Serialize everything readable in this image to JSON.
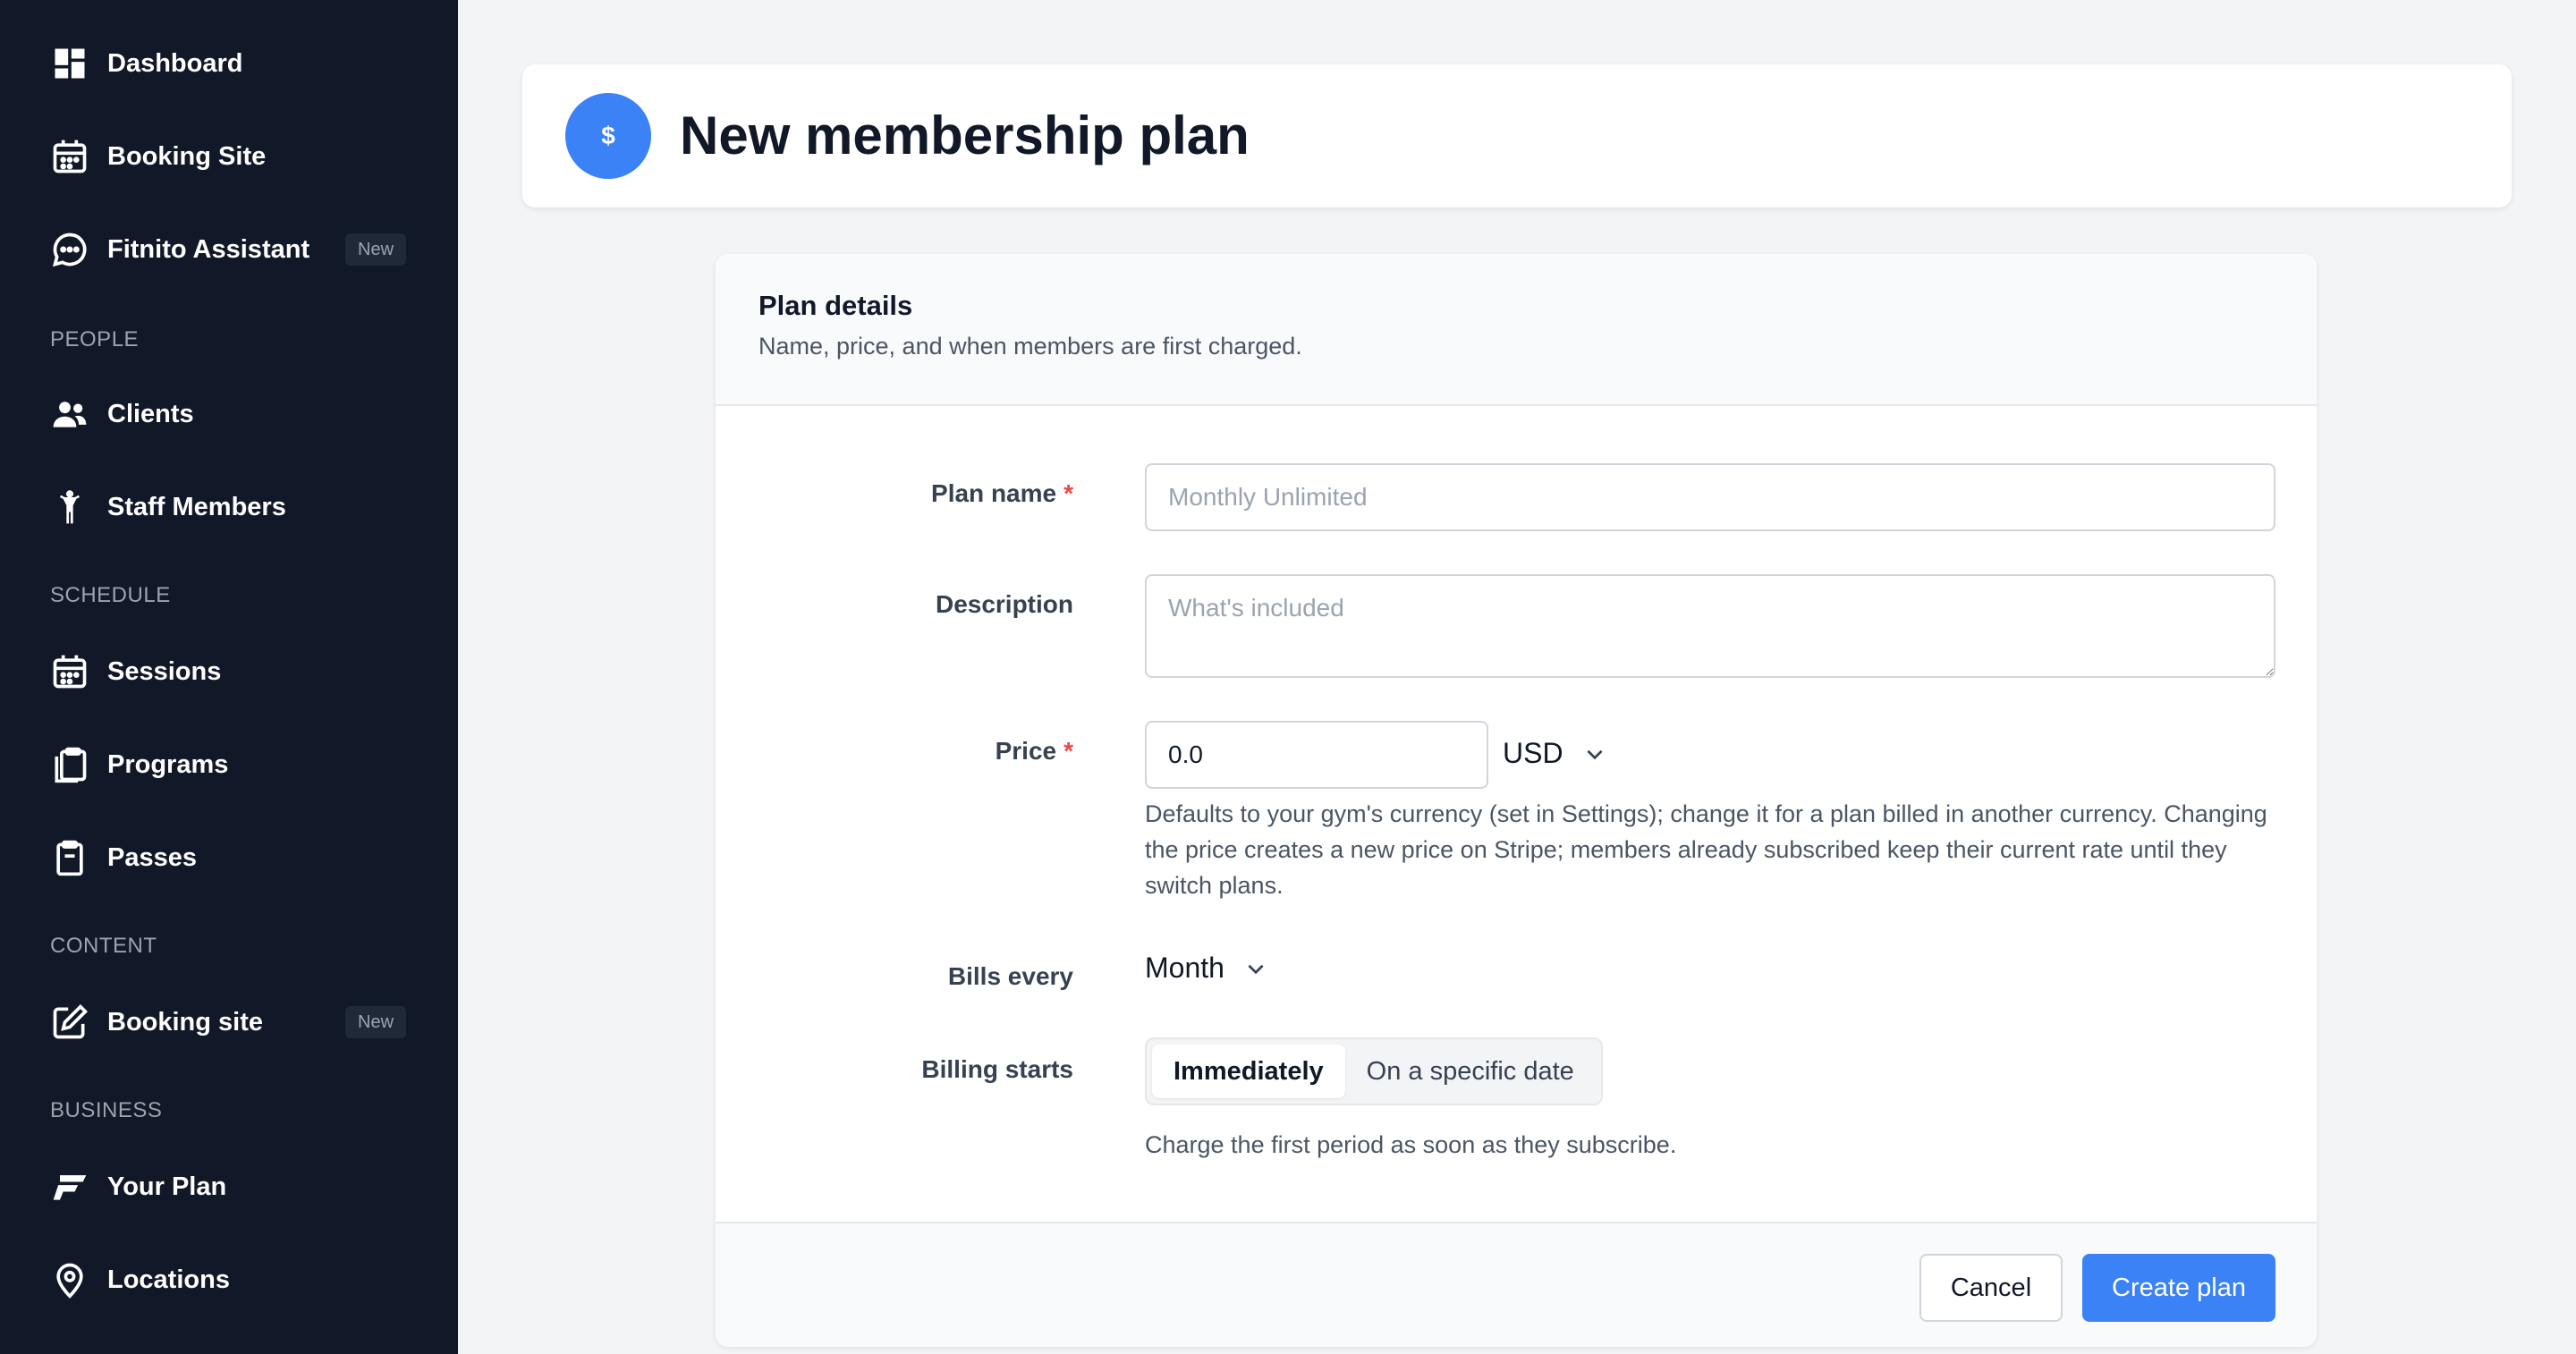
{
  "sidebar": {
    "items": [
      {
        "label": "Dashboard",
        "icon": "dashboard-icon"
      },
      {
        "label": "Booking Site",
        "icon": "calendar-icon"
      },
      {
        "label": "Fitnito Assistant",
        "icon": "chat-icon",
        "badge": "New"
      },
      {
        "label": "Clients",
        "icon": "users-icon"
      },
      {
        "label": "Staff Members",
        "icon": "person-icon"
      },
      {
        "label": "Sessions",
        "icon": "calendar-icon"
      },
      {
        "label": "Programs",
        "icon": "clipboard-stack-icon"
      },
      {
        "label": "Passes",
        "icon": "clipboard-icon"
      },
      {
        "label": "Booking site",
        "icon": "edit-icon",
        "badge": "New"
      },
      {
        "label": "Your Plan",
        "icon": "fitnito-logo-icon"
      },
      {
        "label": "Locations",
        "icon": "map-pin-icon"
      }
    ],
    "sections": {
      "people": "PEOPLE",
      "schedule": "SCHEDULE",
      "content": "CONTENT",
      "business": "BUSINESS"
    }
  },
  "header": {
    "avatar_symbol": "$",
    "title": "New membership plan"
  },
  "form": {
    "title": "Plan details",
    "subtitle": "Name, price, and when members are first charged.",
    "plan_name": {
      "label": "Plan name",
      "required_mark": "*",
      "value": "",
      "placeholder": "Monthly Unlimited"
    },
    "description": {
      "label": "Description",
      "value": "",
      "placeholder": "What's included"
    },
    "price": {
      "label": "Price",
      "required_mark": "*",
      "value": "0.0",
      "currency": "USD",
      "help": "Defaults to your gym's currency (set in Settings); change it for a plan billed in another currency. Changing the price creates a new price on Stripe; members already subscribed keep their current rate until they switch plans."
    },
    "bills_every": {
      "label": "Bills every",
      "value": "Month"
    },
    "billing_starts": {
      "label": "Billing starts",
      "options": [
        "Immediately",
        "On a specific date"
      ],
      "selected": "Immediately",
      "help": "Charge the first period as soon as they subscribe."
    },
    "actions": {
      "cancel": "Cancel",
      "create": "Create plan"
    }
  },
  "colors": {
    "sidebar_bg": "#111827",
    "accent": "#3b82f6",
    "required": "#ef4444"
  }
}
